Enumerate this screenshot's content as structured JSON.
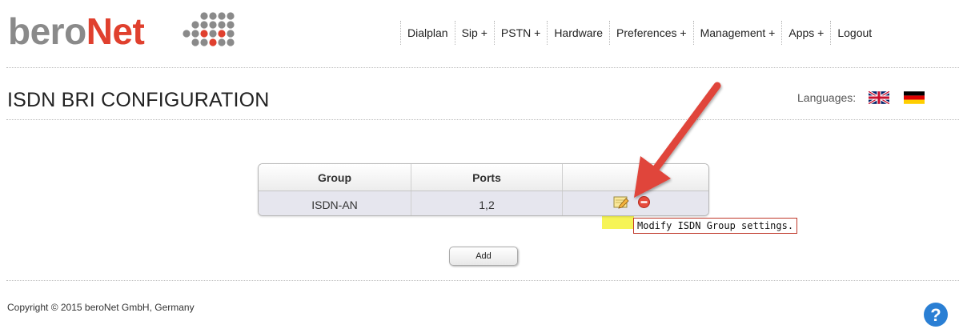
{
  "brand": {
    "name_part1": "bero",
    "name_part2": "Net"
  },
  "nav": {
    "items": [
      "Dialplan",
      "Sip +",
      "PSTN +",
      "Hardware",
      "Preferences +",
      "Management +",
      "Apps +",
      "Logout"
    ]
  },
  "page": {
    "title": "ISDN BRI CONFIGURATION",
    "languages_label": "Languages:"
  },
  "languages": [
    "uk-flag-icon",
    "german-flag-icon"
  ],
  "table": {
    "headers": [
      "Group",
      "Ports",
      ""
    ],
    "rows": [
      {
        "group": "ISDN-AN",
        "ports": "1,2"
      }
    ]
  },
  "row_actions": {
    "edit_icon": "edit-note-icon",
    "delete_icon": "delete-minus-icon"
  },
  "tooltip": "Modify ISDN Group settings.",
  "buttons": {
    "add": "Add"
  },
  "footer": {
    "copyright": "Copyright © 2015 beroNet GmbH, Germany",
    "help_icon": "help-question-icon"
  },
  "colors": {
    "brand_red": "#e0402e",
    "brand_gray": "#8a8a8a",
    "annotation_arrow": "#e0443a",
    "highlight": "#f4f23a",
    "help_blue": "#2a7fd4"
  }
}
